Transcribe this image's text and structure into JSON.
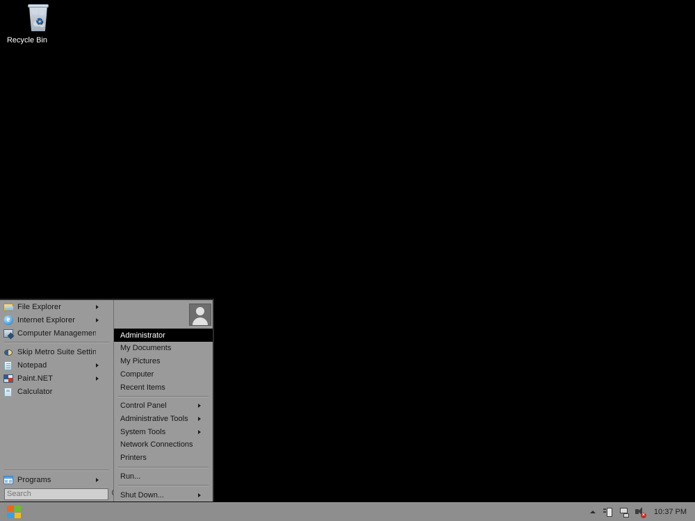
{
  "desktop": {
    "background_color": "#000000",
    "icons": [
      {
        "label": "Recycle Bin",
        "icon": "recycle-bin-icon"
      }
    ]
  },
  "start_menu": {
    "left_panel": {
      "groups": [
        [
          {
            "label": "File Explorer",
            "icon": "folder-icon",
            "has_submenu": true
          },
          {
            "label": "Internet Explorer",
            "icon": "internet-explorer-icon",
            "has_submenu": true
          },
          {
            "label": "Computer Management",
            "icon": "computer-management-icon",
            "has_submenu": false
          }
        ],
        [
          {
            "label": "Skip Metro Suite Settings",
            "icon": "skip-metro-suite-icon",
            "has_submenu": false
          },
          {
            "label": "Notepad",
            "icon": "notepad-icon",
            "has_submenu": true
          },
          {
            "label": "Paint.NET",
            "icon": "paint-net-icon",
            "has_submenu": true
          },
          {
            "label": "Calculator",
            "icon": "calculator-icon",
            "has_submenu": false
          }
        ]
      ],
      "programs": {
        "label": "Programs",
        "icon": "programs-icon",
        "has_submenu": true
      },
      "search": {
        "value": "",
        "placeholder": "Search",
        "button_icon": "search-icon"
      }
    },
    "right_panel": {
      "avatar": {
        "icon": "user-avatar-icon"
      },
      "groups": [
        [
          {
            "label": "Administrator",
            "has_submenu": false,
            "selected": true
          },
          {
            "label": "My Documents",
            "has_submenu": false,
            "selected": false
          },
          {
            "label": "My Pictures",
            "has_submenu": false,
            "selected": false
          },
          {
            "label": "Computer",
            "has_submenu": false,
            "selected": false
          },
          {
            "label": "Recent Items",
            "has_submenu": false,
            "selected": false
          }
        ],
        [
          {
            "label": "Control Panel",
            "has_submenu": true,
            "selected": false
          },
          {
            "label": "Administrative Tools",
            "has_submenu": true,
            "selected": false
          },
          {
            "label": "System Tools",
            "has_submenu": true,
            "selected": false
          },
          {
            "label": "Network Connections",
            "has_submenu": false,
            "selected": false
          },
          {
            "label": "Printers",
            "has_submenu": false,
            "selected": false
          }
        ],
        [
          {
            "label": "Run...",
            "has_submenu": false,
            "selected": false
          }
        ],
        [
          {
            "label": "Shut Down...",
            "has_submenu": true,
            "selected": false
          }
        ]
      ]
    }
  },
  "taskbar": {
    "background_color": "#8e8e8e",
    "start_button": {
      "icon": "windows-logo-icon",
      "label": "Start"
    },
    "tray": {
      "expand_icon": "chevron-up-icon",
      "icons": [
        {
          "icon": "usb-device-icon"
        },
        {
          "icon": "network-icon"
        },
        {
          "icon": "volume-muted-icon",
          "badge": "×"
        }
      ],
      "clock": "10:37 PM"
    }
  }
}
